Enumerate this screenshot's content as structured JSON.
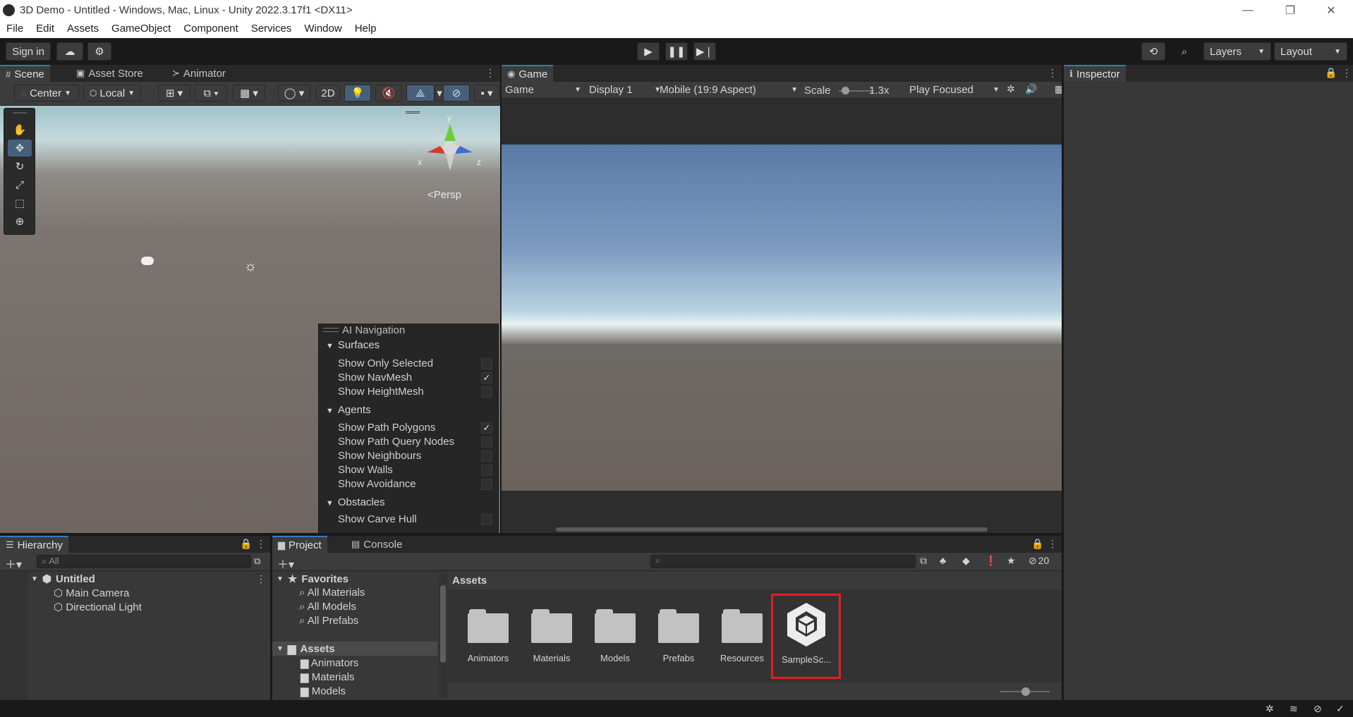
{
  "window": {
    "title": "3D Demo - Untitled - Windows, Mac, Linux - Unity 2022.3.17f1 <DX11>",
    "controls": [
      "—",
      "❐",
      "✕"
    ]
  },
  "menubar": [
    "File",
    "Edit",
    "Assets",
    "GameObject",
    "Component",
    "Services",
    "Window",
    "Help"
  ],
  "toolbar": {
    "sign_in": "Sign in",
    "layers": "Layers",
    "layout": "Layout"
  },
  "scene_panel": {
    "tabs": [
      "Scene",
      "Asset Store",
      "Animator"
    ],
    "pivot": "Center",
    "space": "Local",
    "mode_2d": "2D",
    "persp": "Persp",
    "gizmo_axes": {
      "x": "x",
      "y": "y",
      "z": "z"
    }
  },
  "ai_navigation": {
    "title": "AI Navigation",
    "sections": [
      {
        "name": "Surfaces",
        "items": [
          {
            "label": "Show Only Selected",
            "checked": false
          },
          {
            "label": "Show NavMesh",
            "checked": true
          },
          {
            "label": "Show HeightMesh",
            "checked": false
          }
        ]
      },
      {
        "name": "Agents",
        "items": [
          {
            "label": "Show Path Polygons",
            "checked": true
          },
          {
            "label": "Show Path Query Nodes",
            "checked": false
          },
          {
            "label": "Show Neighbours",
            "checked": false
          },
          {
            "label": "Show Walls",
            "checked": false
          },
          {
            "label": "Show Avoidance",
            "checked": false
          }
        ]
      },
      {
        "name": "Obstacles",
        "items": [
          {
            "label": "Show Carve Hull",
            "checked": false
          }
        ]
      }
    ]
  },
  "game_panel": {
    "tab": "Game",
    "view_mode": "Game",
    "display": "Display 1",
    "aspect": "Mobile (19:9 Aspect)",
    "scale_label": "Scale",
    "scale_value": "1.3x",
    "play_mode": "Play Focused"
  },
  "inspector": {
    "tab": "Inspector"
  },
  "hierarchy": {
    "tab": "Hierarchy",
    "search_placeholder": "All",
    "scene": "Untitled",
    "objects": [
      "Main Camera",
      "Directional Light"
    ]
  },
  "project": {
    "tabs": [
      "Project",
      "Console"
    ],
    "favorites": {
      "label": "Favorites",
      "items": [
        "All Materials",
        "All Models",
        "All Prefabs"
      ]
    },
    "assets_tree": {
      "label": "Assets",
      "items": [
        "Animators",
        "Materials",
        "Models"
      ]
    },
    "breadcrumb": "Assets",
    "hidden_count": "20",
    "assets": [
      "Animators",
      "Materials",
      "Models",
      "Prefabs",
      "Resources",
      "SampleSc..."
    ],
    "highlight_color": "#e02020"
  }
}
